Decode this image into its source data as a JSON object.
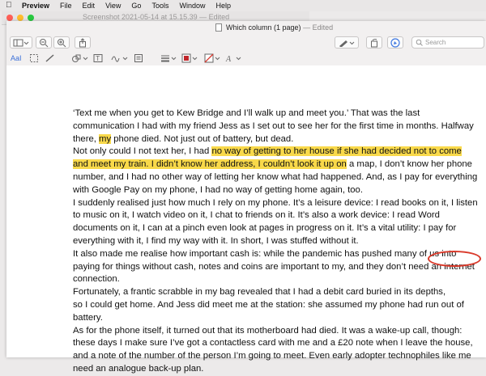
{
  "menu": {
    "apple_icon": "apple-icon",
    "app_name": "Preview",
    "items": [
      "File",
      "Edit",
      "View",
      "Go",
      "Tools",
      "Window",
      "Help"
    ]
  },
  "background_window": {
    "title": "Screenshot 2021-05-14 at 15.15.39",
    "status": "— Edited"
  },
  "window": {
    "title": "Which column (1 page)",
    "status": "— Edited",
    "search_placeholder": "Search",
    "text_tool_label": "AaI"
  },
  "document": {
    "lines": [
      {
        "segments": [
          {
            "text": "‘Text me when you get to Kew Bridge and I’ll walk up and meet you.’ That was the last",
            "hl": false
          }
        ]
      },
      {
        "segments": [
          {
            "text": "communication I had with my friend Jess as I set out to see her for the first time in months. Halfway",
            "hl": false
          }
        ]
      },
      {
        "segments": [
          {
            "text": "there, ",
            "hl": false
          },
          {
            "text": "my",
            "hl": true
          },
          {
            "text": " phone died. Not just out of battery, but dead.",
            "hl": false
          }
        ]
      },
      {
        "segments": [
          {
            "text": "Not only could I not text her, I had ",
            "hl": false
          },
          {
            "text": "no way of getting to her house if she had decided not to come",
            "hl": true
          }
        ]
      },
      {
        "segments": [
          {
            "text": "and meet my train. I didn’t know her address, I couldn’t look it up on",
            "hl": true
          },
          {
            "text": " a map, I don’t know her phone",
            "hl": false
          }
        ]
      },
      {
        "segments": [
          {
            "text": "number, and I had no other way of letting her know what had happened. And, as I pay for everything",
            "hl": false
          }
        ]
      },
      {
        "segments": [
          {
            "text": "with Google Pay on my phone, I had no way of getting home again, too.",
            "hl": false
          }
        ]
      },
      {
        "segments": [
          {
            "text": "I suddenly realised just how much I rely on my phone. It’s a leisure device: I read books on it, I listen",
            "hl": false
          }
        ]
      },
      {
        "segments": [
          {
            "text": "to music on it, I watch video on it, I chat to friends on it. It’s also a work device: I read Word",
            "hl": false
          }
        ]
      },
      {
        "segments": [
          {
            "text": "documents on it, I can at a pinch even look at pages in progress on it. It’s a vital utility: I pay for",
            "hl": false
          }
        ]
      },
      {
        "segments": [
          {
            "text": "everything with it, I find my way with it. In short, I was stuffed without it.",
            "hl": false
          }
        ]
      },
      {
        "segments": [
          {
            "text": "It also made me realise how important cash is: while the pandemic has pushed many of us into",
            "hl": false
          }
        ]
      },
      {
        "segments": [
          {
            "text": "paying for things without cash, notes and coins are important to my, and they don’t need an internet",
            "hl": false
          }
        ]
      },
      {
        "segments": [
          {
            "text": "connection.",
            "hl": false
          }
        ]
      },
      {
        "segments": [
          {
            "text": "Fortunately, a frantic scrabble in my bag revealed that I had a debit card buried in its depths,",
            "hl": false
          }
        ]
      },
      {
        "segments": [
          {
            "text": "so I could get home. And Jess did meet me at the station: she assumed my phone had run out of",
            "hl": false
          }
        ]
      },
      {
        "segments": [
          {
            "text": "battery.",
            "hl": false
          }
        ]
      },
      {
        "segments": [
          {
            "text": "As for the phone itself, it turned out that its motherboard had died. It was a wake-up call, though:",
            "hl": false
          }
        ]
      },
      {
        "segments": [
          {
            "text": "these days I make sure I’ve got a contactless card with me and a £20 note when I leave the house,",
            "hl": false
          }
        ]
      },
      {
        "segments": [
          {
            "text": "and a note of the number of the person I’m going to meet. Even early adopter technophiles like me",
            "hl": false
          }
        ]
      },
      {
        "segments": [
          {
            "text": "need an analogue back-up plan.",
            "hl": false
          }
        ]
      }
    ]
  },
  "colors": {
    "highlight": "#f9d94a",
    "annotation_circle": "#d93a2b",
    "close": "#ff5f57",
    "minimize": "#febc2e",
    "zoom": "#28c840"
  }
}
